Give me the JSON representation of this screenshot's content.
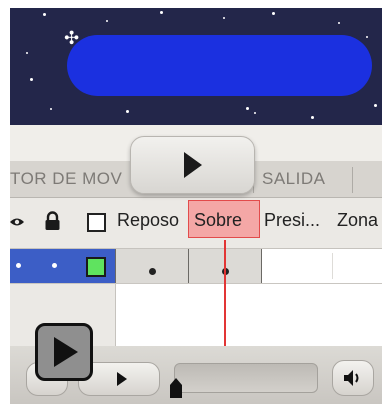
{
  "tabs": {
    "left_label": "TOR DE MOV",
    "right_label": "SALIDA"
  },
  "header": {
    "columns": [
      "Reposo",
      "Sobre",
      "Presi...",
      "Zona"
    ],
    "active_state": "Sobre",
    "icons": [
      "eye-icon",
      "lock-icon",
      "outline-icon"
    ]
  },
  "layer": {
    "selected": true,
    "color": "#5fe35f",
    "keyframes": [
      "Reposo",
      "Sobre"
    ]
  },
  "stage": {
    "background": "#23264a",
    "shape_color": "#1b30e0"
  },
  "controls": {
    "icons": [
      "play-icon",
      "play-icon",
      "speaker-icon"
    ],
    "scrub_position": 0
  },
  "colors": {
    "accent_red": "#e23535",
    "sobre_fill": "#f4a7a6",
    "layer_highlight": "#3c5ec6"
  }
}
